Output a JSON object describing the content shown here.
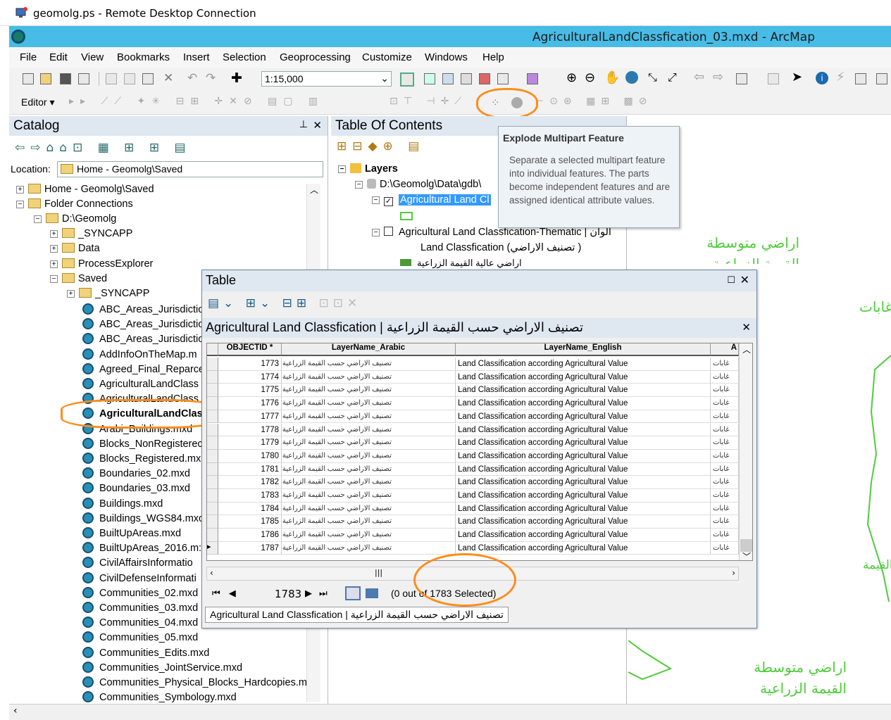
{
  "rdp": {
    "title": "geomolg.ps - Remote Desktop Connection"
  },
  "app": {
    "title": "AgriculturalLandClassfication_03.mxd - ArcMap"
  },
  "menu": [
    "File",
    "Edit",
    "View",
    "Bookmarks",
    "Insert",
    "Selection",
    "Geoprocessing",
    "Customize",
    "Windows",
    "Help"
  ],
  "toolbar": {
    "scale_value": "1:15,000",
    "editor_label": "Editor ▾"
  },
  "catalog": {
    "title": "Catalog",
    "location_label": "Location:",
    "location_value": "Home - Geomolg\\Saved",
    "tree": {
      "home": "Home - Geomolg\\Saved",
      "folder_connections": "Folder Connections",
      "d_geomolg": "D:\\Geomolg",
      "syncapp": "_SYNCAPP",
      "data": "Data",
      "process_explorer": "ProcessExplorer",
      "saved": "Saved",
      "saved_syncapp": "_SYNCAPP"
    },
    "files": [
      "ABC_Areas_Jurisdictio",
      "ABC_Areas_Jurisdictio",
      "ABC_Areas_Jurisdictio",
      "AddInfoOnTheMap.m",
      "Agreed_Final_Reparce",
      "AgriculturalLandClass",
      "AgriculturalLandClass",
      "AgriculturalLandClas:",
      "Arabi_Buildings.mxd",
      "Blocks_NonRegisterec",
      "Blocks_Registered.mx",
      "Boundaries_02.mxd",
      "Boundaries_03.mxd",
      "Buildings.mxd",
      "Buildings_WGS84.mxc",
      "BuiltUpAreas.mxd",
      "BuiltUpAreas_2016.m:",
      "CivilAffairsInformatio",
      "CivilDefenseInformati",
      "Communities_02.mxd",
      "Communities_03.mxd",
      "Communities_04.mxd",
      "Communities_05.mxd",
      "Communities_Edits.mxd",
      "Communities_JointService.mxd",
      "Communities_Physical_Blocks_Hardcopies.m",
      "Communities_Symbology.mxd"
    ]
  },
  "toc": {
    "title": "Table Of Contents",
    "layers_label": "Layers",
    "gdb_path": "D:\\Geomolg\\Data\\gdb\\",
    "layer1": "Agricultural Land Cl",
    "layer2": "Agricultural Land Classfication-Thematic | ألوان",
    "sub_label": "Land Classfication (تصنيف الاراضي )",
    "legend_item": "اراضي عالية القيمة الزراعية"
  },
  "tooltip": {
    "title": "Explode Multipart Feature",
    "body": "Separate a selected multipart feature into individual features. The parts become independent features and are assigned identical attribute values."
  },
  "table_window": {
    "title": "Table",
    "tab_title": "Agricultural Land Classfication  | تصنيف الاراضي حسب القيمة الزراعية",
    "columns": [
      "OBJECTID *",
      "LayerName_Arabic",
      "LayerName_English",
      "A"
    ],
    "rows": [
      {
        "id": "1773",
        "arabic": "تصنيف الاراضي حسب القيمة الزراعية",
        "english": "Land Classification according Agricultural Value",
        "a": "غابات"
      },
      {
        "id": "1774",
        "arabic": "تصنيف الاراضي حسب القيمة الزراعية",
        "english": "Land Classification according Agricultural Value",
        "a": "غابات"
      },
      {
        "id": "1775",
        "arabic": "تصنيف الاراضي حسب القيمة الزراعية",
        "english": "Land Classification according Agricultural Value",
        "a": "غابات"
      },
      {
        "id": "1776",
        "arabic": "تصنيف الاراضي حسب القيمة الزراعية",
        "english": "Land Classification according Agricultural Value",
        "a": "غابات"
      },
      {
        "id": "1777",
        "arabic": "تصنيف الاراضي حسب القيمة الزراعية",
        "english": "Land Classification according Agricultural Value",
        "a": "غابات"
      },
      {
        "id": "1778",
        "arabic": "تصنيف الاراضي حسب القيمة الزراعية",
        "english": "Land Classification according Agricultural Value",
        "a": "غابات"
      },
      {
        "id": "1779",
        "arabic": "تصنيف الاراضي حسب القيمة الزراعية",
        "english": "Land Classification according Agricultural Value",
        "a": "غابات"
      },
      {
        "id": "1780",
        "arabic": "تصنيف الاراضي حسب القيمة الزراعية",
        "english": "Land Classification according Agricultural Value",
        "a": "غابات"
      },
      {
        "id": "1781",
        "arabic": "تصنيف الاراضي حسب القيمة الزراعية",
        "english": "Land Classification according Agricultural Value",
        "a": "غابات"
      },
      {
        "id": "1782",
        "arabic": "تصنيف الاراضي حسب القيمة الزراعية",
        "english": "Land Classification according Agricultural Value",
        "a": "غابات"
      },
      {
        "id": "1783",
        "arabic": "تصنيف الاراضي حسب القيمة الزراعية",
        "english": "Land Classification according Agricultural Value",
        "a": "غابات"
      },
      {
        "id": "1784",
        "arabic": "تصنيف الاراضي حسب القيمة الزراعية",
        "english": "Land Classification according Agricultural Value",
        "a": "غابات"
      },
      {
        "id": "1785",
        "arabic": "تصنيف الاراضي حسب القيمة الزراعية",
        "english": "Land Classification according Agricultural Value",
        "a": "غابات"
      },
      {
        "id": "1786",
        "arabic": "تصنيف الاراضي حسب القيمة الزراعية",
        "english": "Land Classification according Agricultural Value",
        "a": "غابات"
      },
      {
        "id": "1787",
        "arabic": "تصنيف الاراضي حسب القيمة الزراعية",
        "english": "Land Classification according Agricultural Value",
        "a": "غابات"
      }
    ],
    "record_value": "1783",
    "selection_status": "(0 out of 1783 Selected)",
    "bottom_tab": "Agricultural Land Classfication  | تصنيف الاراضي حسب القيمة الزراعية"
  },
  "map": {
    "label1_line1": "اراضي متوسطة",
    "label1_line2": "القيمة الزراعية",
    "label2": "غابات",
    "label3": "القيمة",
    "label4_line1": "اراضي متوسطة",
    "label4_line2": "القيمة الزراعية"
  },
  "colors": {
    "accent_title": "#47bce6",
    "highlight": "#ff8c1a",
    "map_green": "#4fcc3a",
    "selected_layer": "#3399ff"
  }
}
